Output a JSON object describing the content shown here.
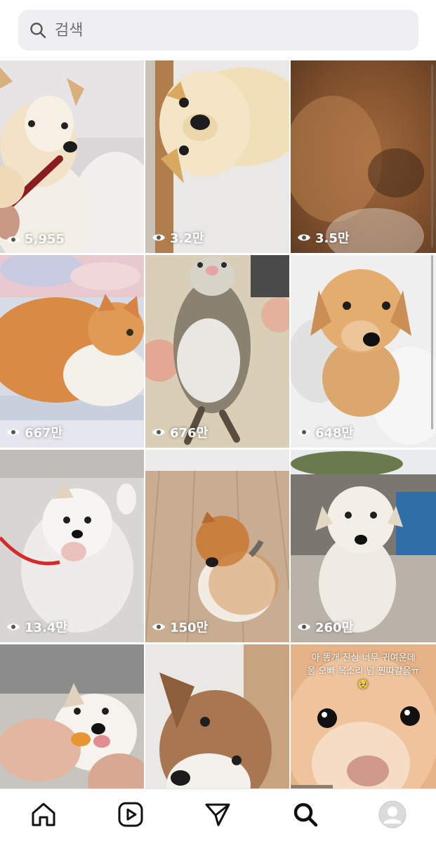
{
  "search": {
    "placeholder": "검색",
    "icon": "search-icon"
  },
  "grid": {
    "tiles": [
      {
        "views": "5,955",
        "subject": "dog"
      },
      {
        "views": "3.2만",
        "subject": "dog"
      },
      {
        "views": "3.5만",
        "subject": "dog-closeup"
      },
      {
        "views": "667만",
        "subject": "cat"
      },
      {
        "views": "676만",
        "subject": "ferret"
      },
      {
        "views": "648만",
        "subject": "puppy"
      },
      {
        "views": "13.4만",
        "subject": "puppy"
      },
      {
        "views": "150만",
        "subject": "puppy"
      },
      {
        "views": "260만",
        "subject": "puppy"
      },
      {
        "views": "",
        "subject": "puppy"
      },
      {
        "views": "",
        "subject": "puppy"
      },
      {
        "views": "",
        "subject": "puppy",
        "caption": "아 똥개 진심 너무 귀여운데\n울 오빠 목소리 넘 찐따같음ㅠ\n🥹"
      }
    ]
  },
  "nav": {
    "items": [
      {
        "icon": "home-icon"
      },
      {
        "icon": "reels-icon"
      },
      {
        "icon": "send-icon"
      },
      {
        "icon": "search-icon",
        "active": true
      },
      {
        "icon": "profile-avatar-icon"
      }
    ]
  }
}
